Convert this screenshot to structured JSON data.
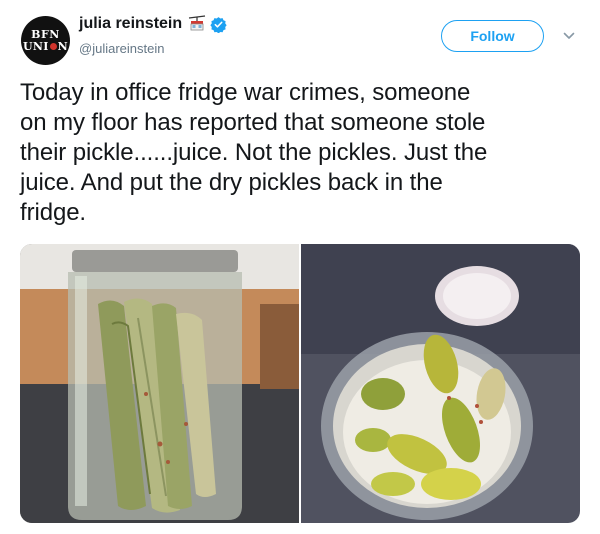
{
  "author": {
    "avatar_text_line1": "BFN",
    "avatar_text_line2_left": "UNI",
    "avatar_text_line2_right": "N",
    "display_name": "julia reinstein",
    "handle": "@juliareinstein",
    "name_emoji_icon": "aerial-tramway-icon",
    "verified_icon": "verified-badge-icon"
  },
  "actions": {
    "follow_label": "Follow",
    "menu_icon": "chevron-down-icon"
  },
  "tweet": {
    "text": "Today in office fridge war crimes, someone\non my floor has reported that someone stole\ntheir pickle......juice. Not the pickles. Just the\njuice. And put the dry pickles back in the\nfridge."
  },
  "media": {
    "photos": [
      {
        "subject": "pickle-jar-side-view"
      },
      {
        "subject": "pickle-jar-top-view"
      }
    ]
  },
  "colors": {
    "accent": "#1da1f2",
    "text": "#14171a",
    "secondary_text": "#657786"
  }
}
